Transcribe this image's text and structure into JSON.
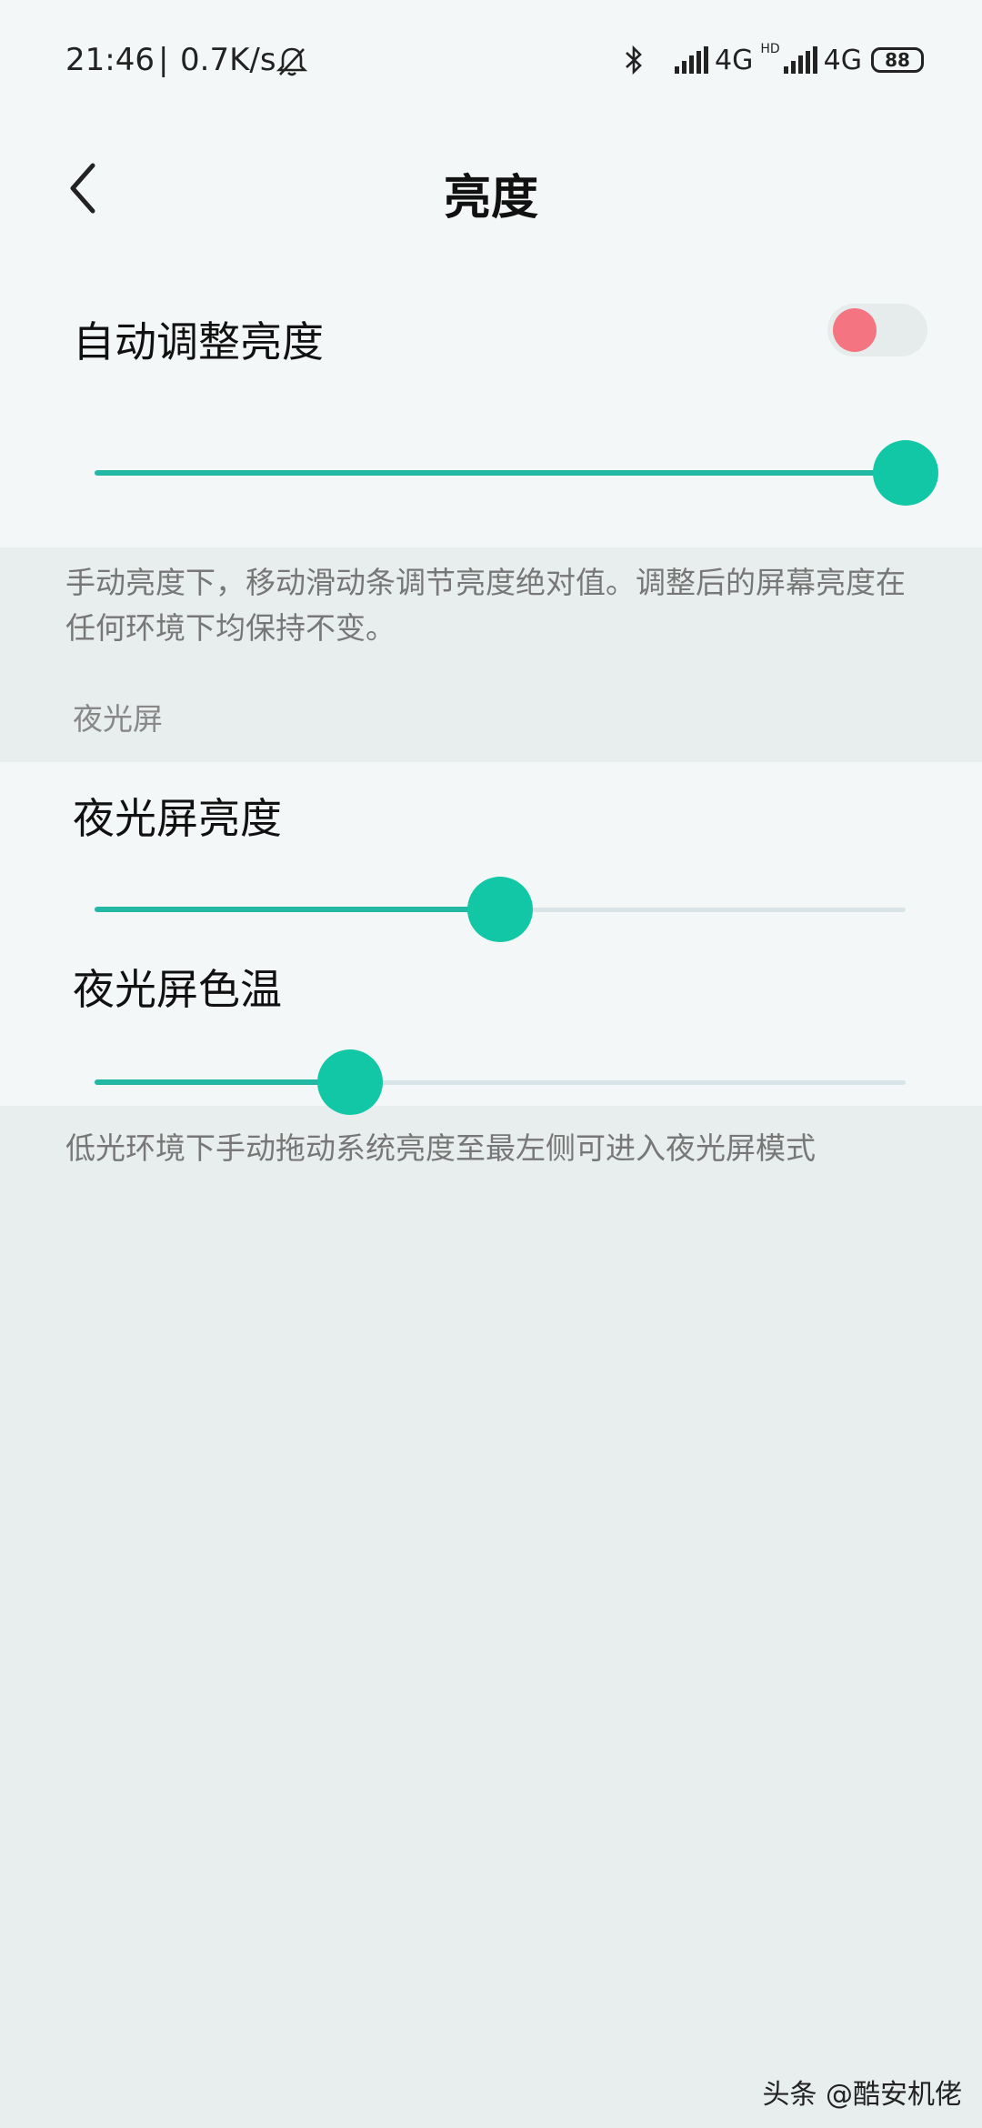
{
  "status_bar": {
    "time": "21:46",
    "separator": "|",
    "net_speed": "0.7K/s",
    "network1": "4G",
    "hd": "HD",
    "network2": "4G",
    "battery": "88",
    "icons": [
      "mute-bell-icon",
      "bluetooth-icon",
      "signal-icon",
      "signal-icon"
    ]
  },
  "header": {
    "title": "亮度",
    "back_icon": "chevron-left-icon"
  },
  "auto_brightness": {
    "label": "自动调整亮度",
    "enabled": false,
    "knob_color": "#f47581"
  },
  "brightness_slider": {
    "value": 1.0
  },
  "manual_description": "手动亮度下，移动滑动条调节亮度绝对值。调整后的屏幕亮度在任何环境下均保持不变。",
  "night_section": {
    "header": "夜光屏",
    "brightness_label": "夜光屏亮度",
    "brightness_value": 0.5,
    "temperature_label": "夜光屏色温",
    "temperature_value": 0.315
  },
  "night_description": "低光环境下手动拖动系统亮度至最左侧可进入夜光屏模式",
  "watermark": "头条 @酷安机佬",
  "colors": {
    "accent": "#12c7a5",
    "track": "#d8e4e8",
    "background": "#e8eeed",
    "card": "#f4f7f7"
  }
}
